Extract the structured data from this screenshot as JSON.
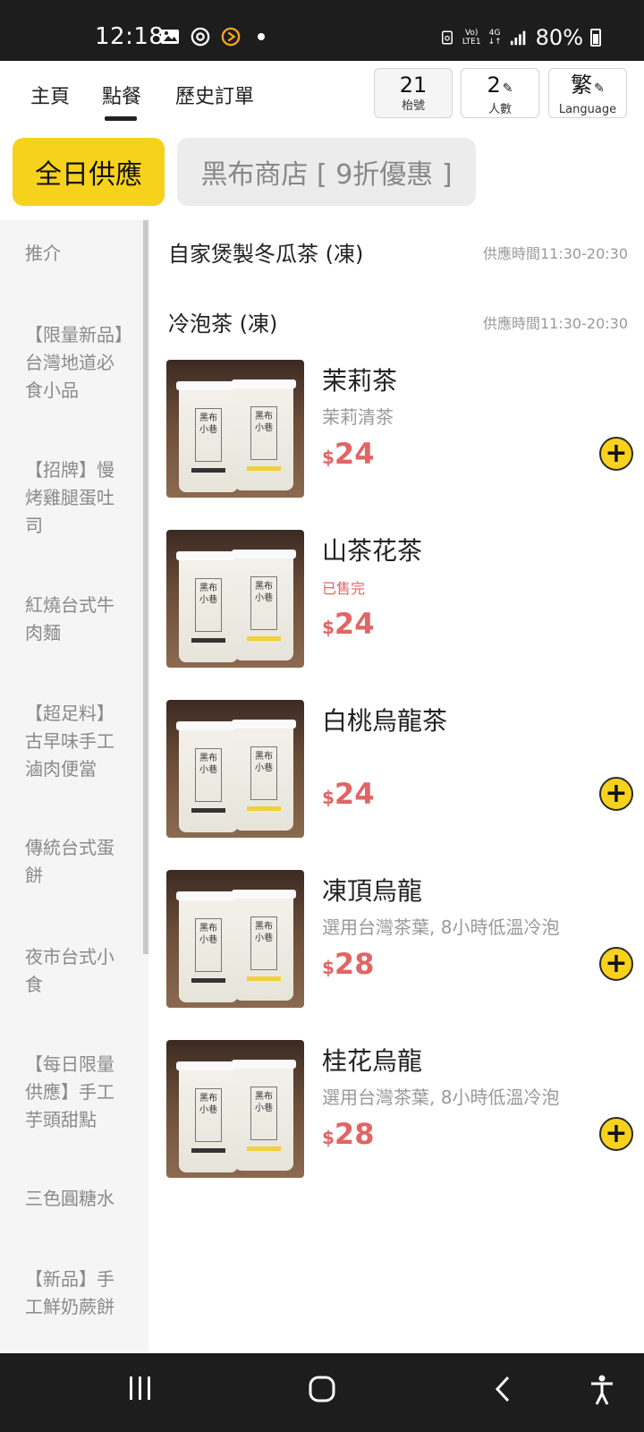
{
  "status_bar": {
    "time": "12:18",
    "battery": "80%",
    "net_top": "Vo)",
    "net_bottom": "LTE1",
    "gen": "4G"
  },
  "nav": {
    "tabs": [
      {
        "label": "主頁"
      },
      {
        "label": "點餐"
      },
      {
        "label": "歷史訂單"
      }
    ],
    "active_tab": "點餐",
    "table": {
      "value": "21",
      "label": "枱號"
    },
    "people": {
      "value": "2",
      "label": "人數"
    },
    "language": {
      "value": "繁",
      "label": "Language"
    }
  },
  "menus": {
    "active": "全日供應",
    "other": "黑布商店 [ 9折優惠 ]"
  },
  "sidebar": {
    "items": [
      {
        "label": "推介"
      },
      {
        "label": "【限量新品】台灣地道必食小品"
      },
      {
        "label": "【招牌】慢烤雞腿蛋吐司"
      },
      {
        "label": "紅燒台式牛肉麵"
      },
      {
        "label": "【超足料】古早味手工滷肉便當"
      },
      {
        "label": "傳統台式蛋餅"
      },
      {
        "label": "夜市台式小食"
      },
      {
        "label": "【每日限量供應】手工芋頭甜點"
      },
      {
        "label": "三色圓糖水"
      },
      {
        "label": "【新品】手工鮮奶蕨餅"
      }
    ]
  },
  "sections": [
    {
      "title": "自家煲製冬瓜茶 (凍)",
      "time": "供應時間11:30-20:30"
    },
    {
      "title": "冷泡茶 (凍)",
      "time": "供應時間11:30-20:30"
    }
  ],
  "products": [
    {
      "name": "茉莉茶",
      "desc": "茉莉清茶",
      "sold_out": "",
      "currency": "$",
      "price": "24",
      "available": true
    },
    {
      "name": "山茶花茶",
      "desc": "",
      "sold_out": "已售完",
      "currency": "$",
      "price": "24",
      "available": false
    },
    {
      "name": "白桃烏龍茶",
      "desc": "",
      "sold_out": "",
      "currency": "$",
      "price": "24",
      "available": true
    },
    {
      "name": "凍頂烏龍",
      "desc": "選用台灣茶葉, 8小時低溫冷泡",
      "sold_out": "",
      "currency": "$",
      "price": "28",
      "available": true
    },
    {
      "name": "桂花烏龍",
      "desc": "選用台灣茶葉, 8小時低溫冷泡",
      "sold_out": "",
      "currency": "$",
      "price": "28",
      "available": true
    }
  ],
  "cup_label": "黑布小巷",
  "colors": {
    "accent": "#f7d21d",
    "price": "#e06565",
    "dark": "#1d1d1d"
  }
}
